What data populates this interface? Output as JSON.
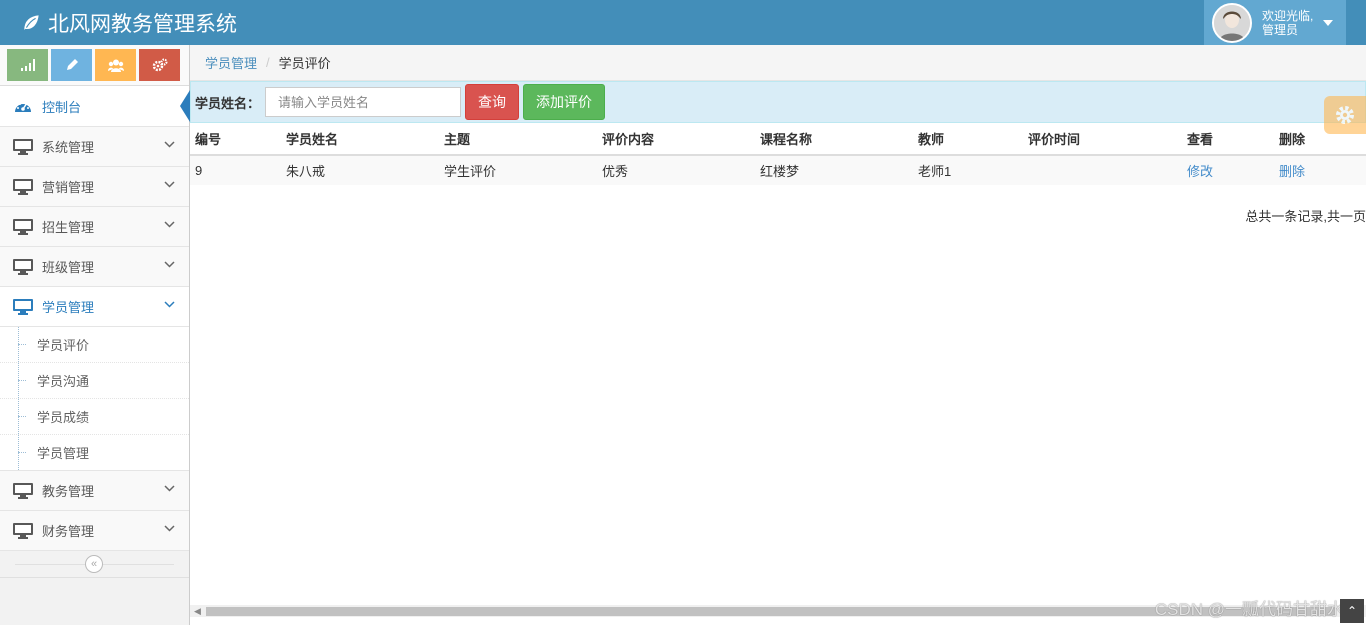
{
  "app": {
    "title": "北风网教务管理系统"
  },
  "user": {
    "welcome_line1": "欢迎光临,",
    "welcome_line2": "管理员"
  },
  "sidebar": {
    "dashboard_label": "控制台",
    "items": [
      {
        "label": "系统管理"
      },
      {
        "label": "营销管理"
      },
      {
        "label": "招生管理"
      },
      {
        "label": "班级管理"
      },
      {
        "label": "学员管理"
      },
      {
        "label": "教务管理"
      },
      {
        "label": "财务管理"
      }
    ],
    "subitems": [
      {
        "label": "学员评价"
      },
      {
        "label": "学员沟通"
      },
      {
        "label": "学员成绩"
      },
      {
        "label": "学员管理"
      }
    ]
  },
  "breadcrumb": {
    "parent": "学员管理",
    "current": "学员评价"
  },
  "search": {
    "label": "学员姓名：",
    "placeholder": "请输入学员姓名",
    "query_button": "查询",
    "add_button": "添加评价"
  },
  "table": {
    "headers": [
      "编号",
      "学员姓名",
      "主题",
      "评价内容",
      "课程名称",
      "教师",
      "评价时间",
      "查看",
      "删除"
    ],
    "rows": [
      {
        "id": "9",
        "name": "朱八戒",
        "subject": "学生评价",
        "content": "优秀",
        "course": "红楼梦",
        "teacher": "老师1",
        "time": "",
        "view": "修改",
        "delete": "删除"
      }
    ]
  },
  "pager": {
    "summary": "总共一条记录,共一页"
  },
  "watermark": "CSDN @一瓢代码甘甜水",
  "colors": {
    "navbar": "#438eb9",
    "user_box": "#62a8d1",
    "accent": "#2b7dbc",
    "danger": "#d9534f",
    "success": "#5cb85c",
    "warning": "#ffb752"
  },
  "icons": [
    "leaf-icon",
    "signal-icon",
    "pencil-icon",
    "users-icon",
    "cogs-icon",
    "dashboard-icon",
    "desktop-icon",
    "chevron-down-icon",
    "double-angle-left-icon",
    "gear-icon",
    "angle-up-icon"
  ]
}
